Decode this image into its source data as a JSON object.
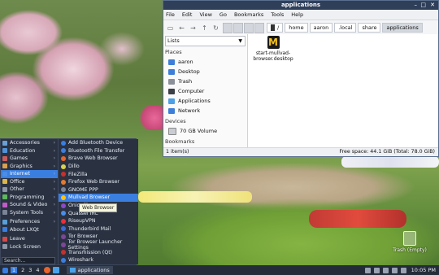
{
  "file_manager": {
    "title": "applications",
    "window_controls": [
      "–",
      "□",
      "✕"
    ],
    "menu": [
      "File",
      "Edit",
      "View",
      "Go",
      "Bookmarks",
      "Tools",
      "Help"
    ],
    "breadcrumbs": [
      "/",
      "home",
      "aaron",
      ".local",
      "share",
      "applications"
    ],
    "side_view": "Lists",
    "places_heading": "Places",
    "places": [
      {
        "label": "aaron",
        "color": "#3d7fd8"
      },
      {
        "label": "Desktop",
        "color": "#3d7fd8"
      },
      {
        "label": "Trash",
        "color": "#8b9099"
      },
      {
        "label": "Computer",
        "color": "#3b3f46"
      },
      {
        "label": "Applications",
        "color": "#4da0e6"
      },
      {
        "label": "Network",
        "color": "#3d7fd8"
      }
    ],
    "devices_heading": "Devices",
    "devices": [
      {
        "label": "70 GB Volume"
      }
    ],
    "bookmarks_heading": "Bookmarks",
    "file": {
      "icon_letter": "M",
      "name_line1": "start-mullvad-",
      "name_line2": "browser.desktop"
    },
    "status_left": "1 item(s)",
    "status_right": "Free space: 44.1 GiB (Total: 78.0 GiB)"
  },
  "desktop_trash_label": "Trash (Empty)",
  "start_menu": {
    "categories": [
      {
        "label": "Accessories",
        "color": "#6aa0d8",
        "submenu": true
      },
      {
        "label": "Education",
        "color": "#4e93d9",
        "submenu": true
      },
      {
        "label": "Games",
        "color": "#c85c5c",
        "submenu": true
      },
      {
        "label": "Graphics",
        "color": "#d9a04e",
        "submenu": true
      },
      {
        "label": "Internet",
        "color": "#4a8ee8",
        "submenu": true
      },
      {
        "label": "Office",
        "color": "#d9b64e",
        "submenu": true
      },
      {
        "label": "Other",
        "color": "#8c95a5",
        "submenu": true
      },
      {
        "label": "Programming",
        "color": "#5cb85c",
        "submenu": true
      },
      {
        "label": "Sound & Video",
        "color": "#c05cc8",
        "submenu": true
      },
      {
        "label": "System Tools",
        "color": "#7a8496",
        "submenu": true
      },
      {
        "label": "Preferences",
        "color": "#5a9fd8",
        "submenu": true
      },
      {
        "label": "About LXQt",
        "color": "#3a7ee0",
        "submenu": false
      },
      {
        "label": "Leave",
        "color": "#d24a4a",
        "submenu": true
      },
      {
        "label": "Lock Screen",
        "color": "#8c95a5",
        "submenu": false
      }
    ],
    "active_category": "Internet",
    "search_placeholder": "Search...",
    "apps": [
      {
        "label": "Add Bluetooth Device",
        "color": "#3a7ee0"
      },
      {
        "label": "Bluetooth File Transfer",
        "color": "#3a7ee0"
      },
      {
        "label": "Brave Web Browser",
        "color": "#e8642c"
      },
      {
        "label": "Dillo",
        "color": "#d9d24e"
      },
      {
        "label": "FileZilla",
        "color": "#c8302c"
      },
      {
        "label": "Firefox Web Browser",
        "color": "#e87a2c"
      },
      {
        "label": "GNOME PPP",
        "color": "#7a8496"
      },
      {
        "label": "Mullvad Browser",
        "color": "#f7c21b"
      },
      {
        "label": "OnionShare",
        "color": "#8a4ac8"
      },
      {
        "label": "Quassel IRC",
        "color": "#4a8ee8"
      },
      {
        "label": "RiseupVPN",
        "color": "#e8303a"
      },
      {
        "label": "Thunderbird Mail",
        "color": "#3a6ad8"
      },
      {
        "label": "Tor Browser",
        "color": "#7d4698"
      },
      {
        "label": "Tor Browser Launcher Settings",
        "color": "#7d4698"
      },
      {
        "label": "Transmission (Qt)",
        "color": "#c8302c"
      },
      {
        "label": "Wireshark",
        "color": "#3a7ee0"
      }
    ],
    "active_app": "Mullvad Browser",
    "tooltip": "Web Browser"
  },
  "taskbar": {
    "workspaces": [
      "1",
      "2",
      "3",
      "4"
    ],
    "active_workspace": "1",
    "task_label": "applications",
    "clock": "10:05 PM",
    "accent": "#3a7ee0"
  }
}
